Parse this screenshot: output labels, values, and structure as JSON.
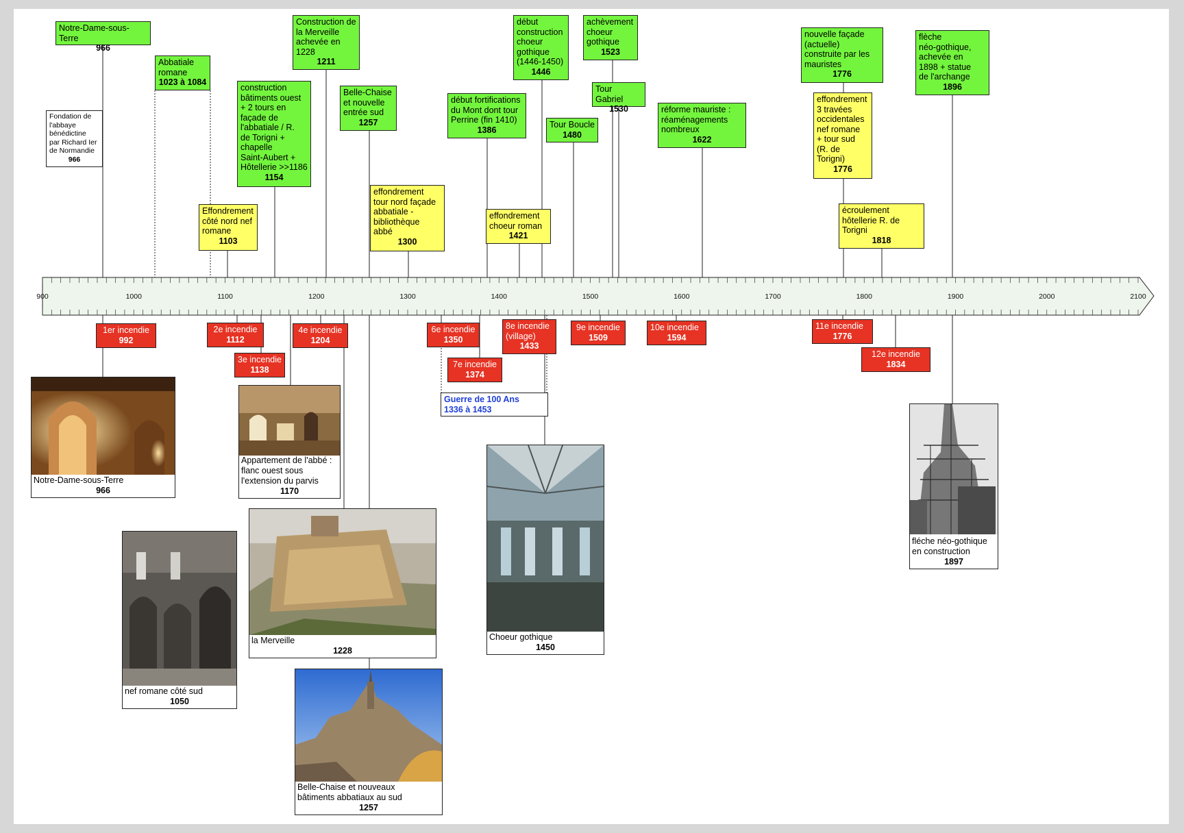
{
  "axis": {
    "labels": [
      "900",
      "1000",
      "1100",
      "1200",
      "1300",
      "1400",
      "1500",
      "1600",
      "1700",
      "1800",
      "1900",
      "2000",
      "2100"
    ]
  },
  "events_above": [
    {
      "text": "Notre-Dame-sous-Terre",
      "year": "966"
    },
    {
      "text": "Fondation de\nl'abbaye\nbénédictine\npar Richard Ier\nde Normandie",
      "year": "966"
    },
    {
      "text": "Abbatiale\nromane",
      "year": "1023 à 1084"
    },
    {
      "text": "Effondrement\ncôté nord nef\nromane",
      "year": "1103"
    },
    {
      "text": "construction\nbâtiments ouest\n+ 2 tours en\nfaçade de\nl'abbatiale / R.\nde Torigni +\nchapelle\nSaint-Aubert +\nHôtellerie >>1186",
      "year": "1154"
    },
    {
      "text": "Construction de\nla Merveille\nachevée en\n1228",
      "year": "1211"
    },
    {
      "text": "Belle-Chaise\net nouvelle\nentrée sud",
      "year": "1257"
    },
    {
      "text": "effondrement\ntour nord façade\nabbatiale -\nbibliothèque\nabbé",
      "year": "1300"
    },
    {
      "text": "début fortifications\ndu Mont dont tour\nPerrine (fin 1410)",
      "year": "1386"
    },
    {
      "text": "effondrement\nchoeur roman",
      "year": "1421"
    },
    {
      "text": "début\nconstruction\nchoeur\ngothique\n(1446-1450)",
      "year": "1446"
    },
    {
      "text": "Tour Boucle",
      "year": "1480"
    },
    {
      "text": "achèvement\nchoeur\ngothique",
      "year": "1523"
    },
    {
      "text": "Tour Gabriel",
      "year": "1530"
    },
    {
      "text": "réforme mauriste :\nréaménagements\nnombreux",
      "year": "1622"
    },
    {
      "text": "nouvelle façade\n(actuelle)\nconstruite par les\nmauristes",
      "year": "1776"
    },
    {
      "text": "effondrement\n3 travées\noccidentales\nnef romane\n+ tour sud\n(R. de\nTorigni)",
      "year": "1776"
    },
    {
      "text": "écroulement\nhôtellerie R. de\nTorigni",
      "year": "1818"
    },
    {
      "text": "flèche\nnéo-gothique,\nachevée en\n1898 + statue\nde l'archange",
      "year": "1896"
    }
  ],
  "fires": [
    {
      "text": "1er incendie",
      "year": "992"
    },
    {
      "text": "2e incendie",
      "year": "1112"
    },
    {
      "text": "3e incendie",
      "year": "1138"
    },
    {
      "text": "4e incendie",
      "year": "1204"
    },
    {
      "text": "6e incendie",
      "year": "1350"
    },
    {
      "text": "7e incendie",
      "year": "1374"
    },
    {
      "text": "8e incendie\n(village)",
      "year": "1433"
    },
    {
      "text": "9e incendie",
      "year": "1509"
    },
    {
      "text": "10e incendie",
      "year": "1594"
    },
    {
      "text": "11e incendie",
      "year": "1776"
    },
    {
      "text": "12e incendie",
      "year": "1834"
    }
  ],
  "war": {
    "text": "Guerre de 100 Ans",
    "year": "1336 à 1453"
  },
  "photos": [
    {
      "caption": "Notre-Dame-sous-Terre",
      "year": "966",
      "icon": "crypt-photo"
    },
    {
      "caption": "nef romane côté sud",
      "year": "1050",
      "icon": "nave-photo"
    },
    {
      "caption": "Appartement de l'abbé :\nflanc ouest sous\nl'extension du parvis",
      "year": "1170",
      "icon": "abbot-room-photo"
    },
    {
      "caption": "la Merveille",
      "year": "1228",
      "icon": "merveille-photo"
    },
    {
      "caption": "Belle-Chaise et nouveaux\nbâtiments abbatiaux au sud",
      "year": "1257",
      "icon": "abbey-photo"
    },
    {
      "caption": "Choeur gothique",
      "year": "1450",
      "icon": "choir-vault-photo"
    },
    {
      "caption": "fléche néo-gothique\nen construction",
      "year": "1897",
      "icon": "spire-scaffold-photo"
    }
  ],
  "colors": {
    "construction": "#73f53e",
    "collapse": "#ffff66",
    "fire": "#e63324",
    "war": "#1f3fd6",
    "timeline": "#eef5ec"
  }
}
